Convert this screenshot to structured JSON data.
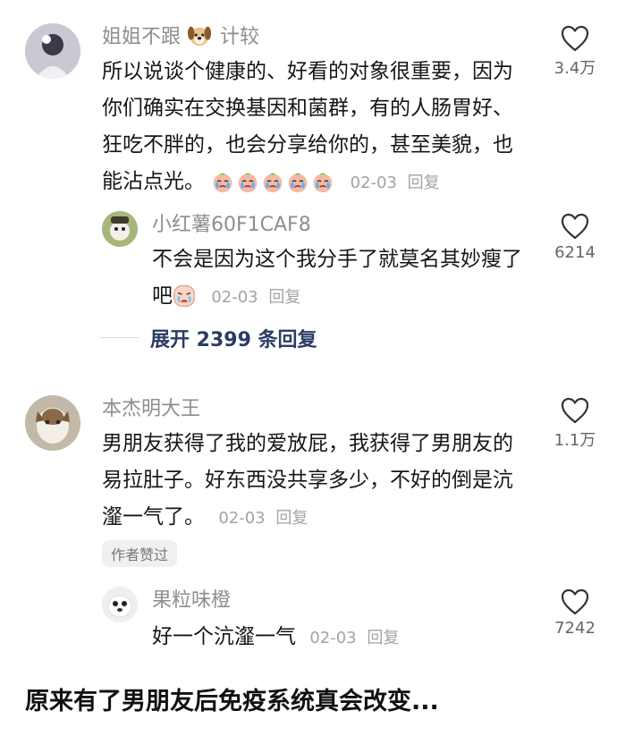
{
  "comments": [
    {
      "username": "姐姐不跟",
      "username_suffix": "计较",
      "username_emoji": "dog-face",
      "text": "所以说谈个健康的、好看的对象很重要，因为你们确实在交换基因和菌群，有的人肠胃好、狂吃不胖的，也会分享给你的，甚至美貌，也能沾点光。",
      "emojis": [
        "crying-peach",
        "crying-peach",
        "crying-peach",
        "crying-peach",
        "crying-peach"
      ],
      "date": "02-03",
      "reply_label": "回复",
      "likes": "3.4万"
    },
    {
      "username": "小红薯60F1CAF8",
      "text": "不会是因为这个我分手了就莫名其妙瘦了吧",
      "emojis": [
        "crying-face"
      ],
      "date": "02-03",
      "reply_label": "回复",
      "likes": "6214"
    },
    {
      "username": "本杰明大王",
      "text": "男朋友获得了我的爱放屁，我获得了男朋友的易拉肚子。好东西没共享多少，不好的倒是沆瀣一气了。",
      "date": "02-03",
      "reply_label": "回复",
      "likes": "1.1万",
      "badge": "作者赞过"
    },
    {
      "username": "果粒味橙",
      "text": "好一个沆瀣一气",
      "date": "02-03",
      "reply_label": "回复",
      "likes": "7242"
    }
  ],
  "expand_replies": "展开 2399 条回复",
  "bottom_title": "原来有了男朋友后免疫系统真会改变...",
  "colors": {
    "username": "#8e8e8e",
    "text": "#161616",
    "meta": "#a3a3a3",
    "expand": "#2b3c63"
  },
  "icons": [
    "heart-outline-icon",
    "dog-face",
    "crying-peach",
    "crying-face"
  ]
}
